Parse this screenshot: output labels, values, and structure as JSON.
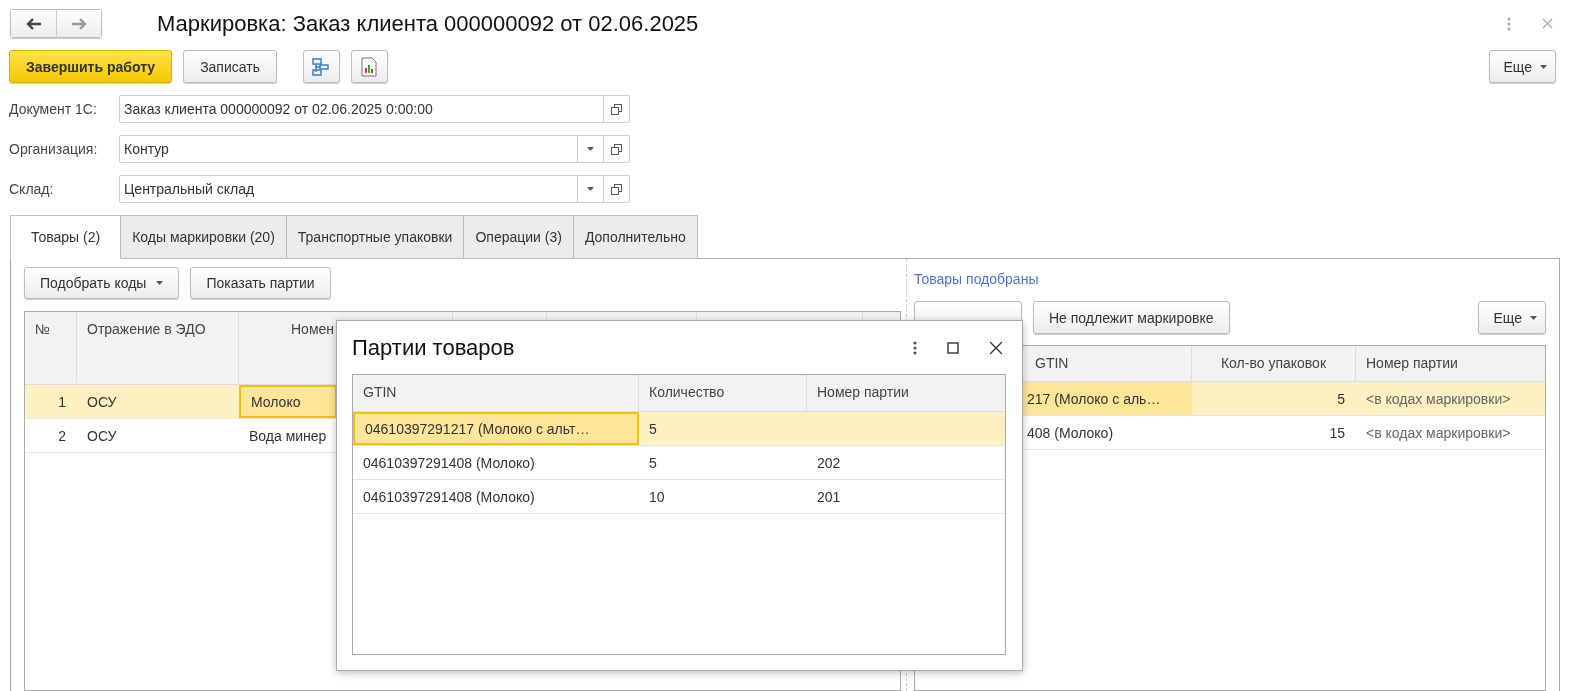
{
  "window": {
    "title": "Маркировка: Заказ клиента 000000092 от 02.06.2025"
  },
  "toolbar": {
    "buttons": [
      {
        "label": "Завершить работу",
        "kind": "primary"
      },
      {
        "label": "Записать",
        "kind": "normal"
      }
    ],
    "more": "Еще"
  },
  "fields": [
    {
      "label": "Документ 1С:",
      "value": "Заказ клиента 000000092 от 02.06.2025 0:00:00",
      "dropdown": false
    },
    {
      "label": "Организация:",
      "value": "Контур",
      "dropdown": true
    },
    {
      "label": "Склад:",
      "value": "Центральный склад",
      "dropdown": true
    }
  ],
  "tabs": [
    {
      "label": "Товары (2)",
      "selected": true
    },
    {
      "label": "Коды маркировки (20)",
      "selected": false
    },
    {
      "label": "Транспортные упаковки",
      "selected": false
    },
    {
      "label": "Операции (3)",
      "selected": false
    },
    {
      "label": "Дополнительно",
      "selected": false
    }
  ],
  "left": {
    "buttons": [
      {
        "label": "Подобрать коды",
        "dropdown": true
      },
      {
        "label": "Показать партии",
        "dropdown": false
      }
    ],
    "columns": [
      "№",
      "Отражение в ЭДО",
      "Номен"
    ],
    "rows": [
      {
        "selected": true,
        "cells": [
          {
            "text": "1",
            "current": false
          },
          {
            "text": "ОСУ",
            "current": false
          },
          {
            "text": "Молоко",
            "current": true
          }
        ]
      },
      {
        "selected": false,
        "cells": [
          {
            "text": "2",
            "current": false
          },
          {
            "text": "ОСУ",
            "current": false
          },
          {
            "text": "Вода минер",
            "current": false
          }
        ]
      }
    ]
  },
  "right": {
    "link": "Товары подобраны",
    "buttons": [
      "Не подлежит маркировке"
    ],
    "more": "Еще",
    "columns": [
      "GTIN",
      "Кол-во упаковок",
      "Номер партии"
    ],
    "rows": [
      {
        "selected": true,
        "cells": [
          {
            "text": "217 (Молоко с аль…",
            "current": true
          },
          {
            "text": "5",
            "current": false
          },
          {
            "text": "<в кодах маркировки>",
            "current": false
          }
        ]
      },
      {
        "selected": false,
        "cells": [
          {
            "text": "408 (Молоко)",
            "current": false
          },
          {
            "text": "15",
            "current": false
          },
          {
            "text": "<в кодах маркировки>",
            "current": false
          }
        ]
      }
    ]
  },
  "dialog": {
    "title": "Партии товаров",
    "columns": [
      "GTIN",
      "Количество",
      "Номер партии"
    ],
    "rows": [
      {
        "selected": true,
        "cells": [
          {
            "text": "04610397291217 (Молоко с альт…",
            "current": true
          },
          {
            "text": "5",
            "current": false
          },
          {
            "current": false
          }
        ]
      },
      {
        "selected": false,
        "cells": [
          {
            "text": "04610397291408 (Молоко)",
            "current": false
          },
          {
            "text": "5",
            "current": false
          },
          {
            "text": "202",
            "current": false
          }
        ]
      },
      {
        "selected": false,
        "cells": [
          {
            "text": "04610397291408 (Молоко)",
            "current": false
          },
          {
            "text": "10",
            "current": false
          },
          {
            "text": "201",
            "current": false
          }
        ]
      }
    ]
  }
}
